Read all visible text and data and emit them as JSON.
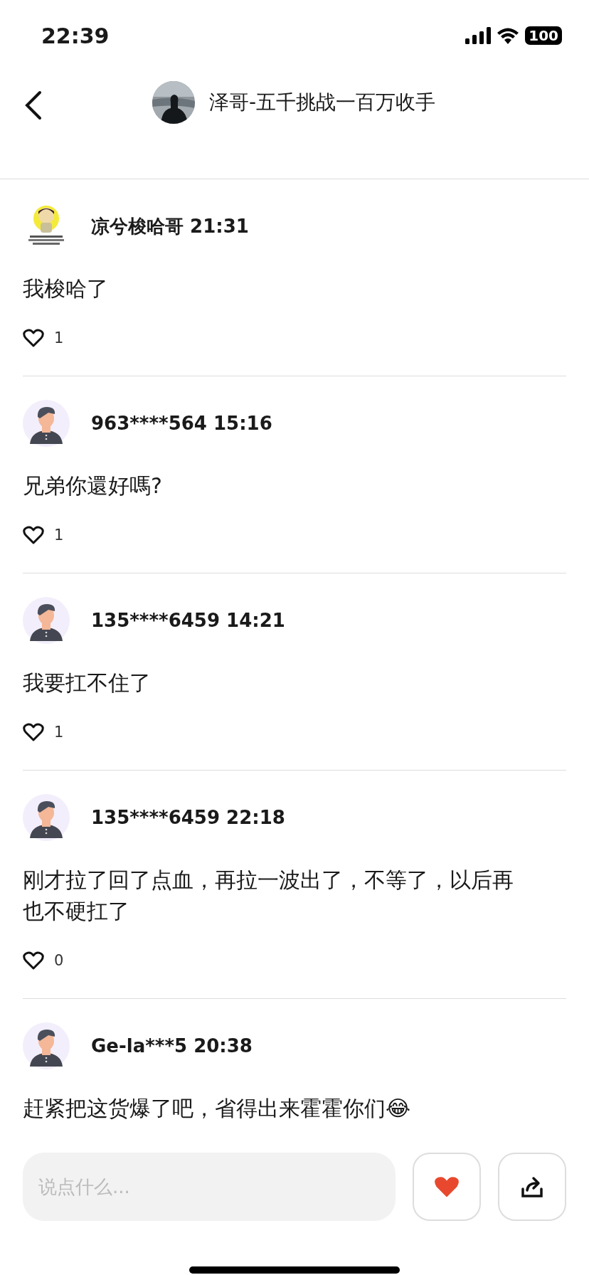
{
  "status_bar": {
    "time": "22:39",
    "battery": "100"
  },
  "header": {
    "title": "泽哥-五千挑战一百万收手"
  },
  "comments": [
    {
      "kind": "cartoon",
      "author": "凉兮梭哈哥",
      "time": "21:31",
      "text": "我梭哈了",
      "likes": "1"
    },
    {
      "kind": "default",
      "author": "963****564",
      "time": "15:16",
      "text": "兄弟你還好嗎?",
      "likes": "1"
    },
    {
      "kind": "default",
      "author": "135****6459",
      "time": "14:21",
      "text": "我要扛不住了",
      "likes": "1"
    },
    {
      "kind": "default",
      "author": "135****6459",
      "time": "22:18",
      "text": "刚才拉了回了点血，再拉一波出了，不等了，以后再也不硬扛了",
      "likes": "0"
    },
    {
      "kind": "default",
      "author": "Ge-la***5",
      "time": "20:38",
      "text": "赶紧把这货爆了吧，省得出来霍霍你们😂"
    }
  ],
  "composer": {
    "placeholder": "说点什么..."
  }
}
